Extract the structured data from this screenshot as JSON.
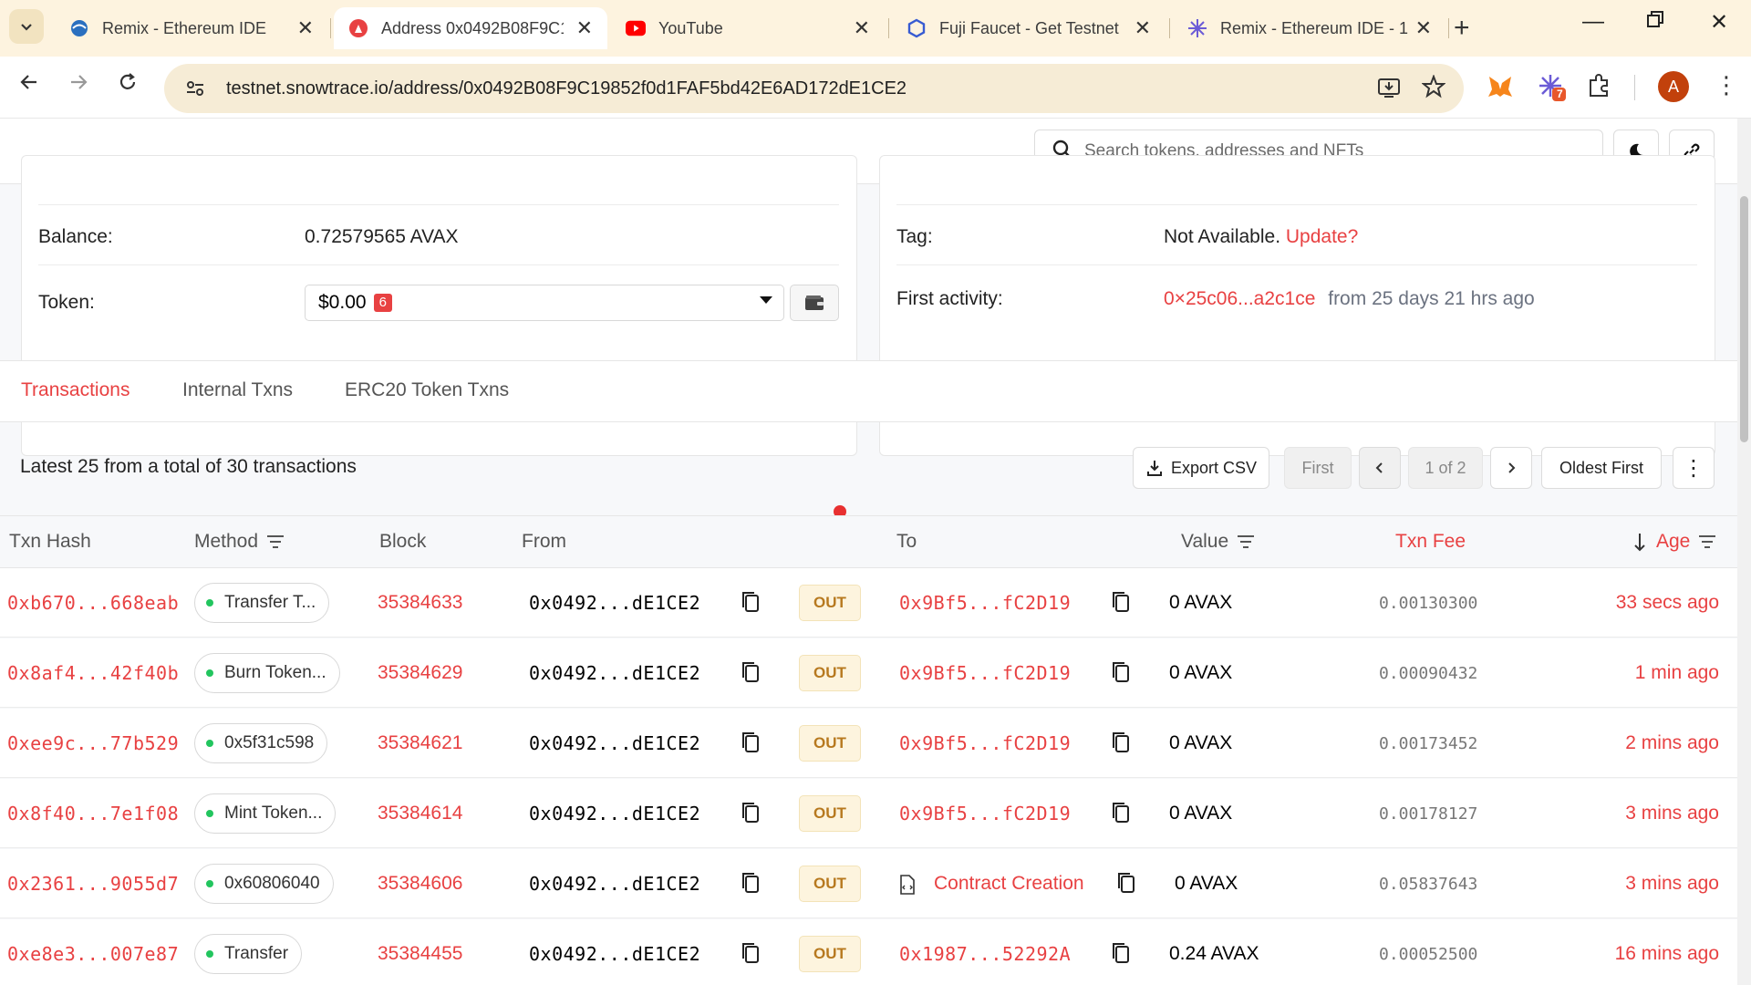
{
  "browser": {
    "tabs": [
      {
        "title": "Remix - Ethereum IDE",
        "icon": "remix-icon"
      },
      {
        "title": "Address 0x0492B08F9C1’",
        "icon": "avalanche-icon",
        "active": true
      },
      {
        "title": "YouTube",
        "icon": "youtube-icon"
      },
      {
        "title": "Fuji Faucet - Get Testnet",
        "icon": "chainlink-icon"
      },
      {
        "title": "Remix - Ethereum IDE - 1",
        "icon": "remix-icon"
      }
    ],
    "url": "testnet.snowtrace.io/address/0x0492B08F9C19852f0d1FAF5bd42E6AD172dE1CE2",
    "extension_badge": "7",
    "profile_initial": "A"
  },
  "header": {
    "search_placeholder": "Search tokens, addresses and NFTs"
  },
  "overview": {
    "balance_label": "Balance:",
    "balance_value": "0.72579565 AVAX",
    "token_label": "Token:",
    "token_value": "$0.00",
    "token_count": "6"
  },
  "more_info": {
    "tag_label": "Tag:",
    "tag_value": "Not Available.",
    "tag_update": "Update?",
    "first_activity_label": "First activity:",
    "first_activity_hash": "0×25c06...a2c1ce",
    "first_activity_time": "from 25 days 21 hrs ago"
  },
  "tabs": {
    "transactions": "Transactions",
    "internal": "Internal Txns",
    "erc20": "ERC20 Token Txns"
  },
  "summary": "Latest 25 from a total of 30 transactions",
  "pagination": {
    "export": "Export CSV",
    "first": "First",
    "page": "1 of 2",
    "oldest": "Oldest First"
  },
  "table": {
    "headers": {
      "hash": "Txn Hash",
      "method": "Method",
      "block": "Block",
      "from": "From",
      "to": "To",
      "value": "Value",
      "fee": "Txn Fee",
      "age": "Age"
    },
    "rows": [
      {
        "hash": "0xb670...668eab",
        "method": "Transfer T...",
        "block": "35384633",
        "from": "0x0492...dE1CE2",
        "dir": "OUT",
        "to": "0x9Bf5...fC2D19",
        "value": "0 AVAX",
        "fee": "0.00130300",
        "age": "33 secs ago"
      },
      {
        "hash": "0x8af4...42f40b",
        "method": "Burn Token...",
        "block": "35384629",
        "from": "0x0492...dE1CE2",
        "dir": "OUT",
        "to": "0x9Bf5...fC2D19",
        "value": "0 AVAX",
        "fee": "0.00090432",
        "age": "1 min ago"
      },
      {
        "hash": "0xee9c...77b529",
        "method": "0x5f31c598",
        "block": "35384621",
        "from": "0x0492...dE1CE2",
        "dir": "OUT",
        "to": "0x9Bf5...fC2D19",
        "value": "0 AVAX",
        "fee": "0.00173452",
        "age": "2 mins ago"
      },
      {
        "hash": "0x8f40...7e1f08",
        "method": "Mint Token...",
        "block": "35384614",
        "from": "0x0492...dE1CE2",
        "dir": "OUT",
        "to": "0x9Bf5...fC2D19",
        "value": "0 AVAX",
        "fee": "0.00178127",
        "age": "3 mins ago"
      },
      {
        "hash": "0x2361...9055d7",
        "method": "0x60806040",
        "block": "35384606",
        "from": "0x0492...dE1CE2",
        "dir": "OUT",
        "to": "Contract Creation",
        "value": "0 AVAX",
        "fee": "0.05837643",
        "age": "3 mins ago"
      },
      {
        "hash": "0xe8e3...007e87",
        "method": "Transfer",
        "block": "35384455",
        "from": "0x0492...dE1CE2",
        "dir": "OUT",
        "to": "0x1987...52292A",
        "value": "0.24 AVAX",
        "fee": "0.00052500",
        "age": "16 mins ago"
      }
    ]
  },
  "colors": {
    "accent": "#e84142",
    "out_badge_bg": "#fdf4de",
    "method_dot": "#22c55e"
  }
}
